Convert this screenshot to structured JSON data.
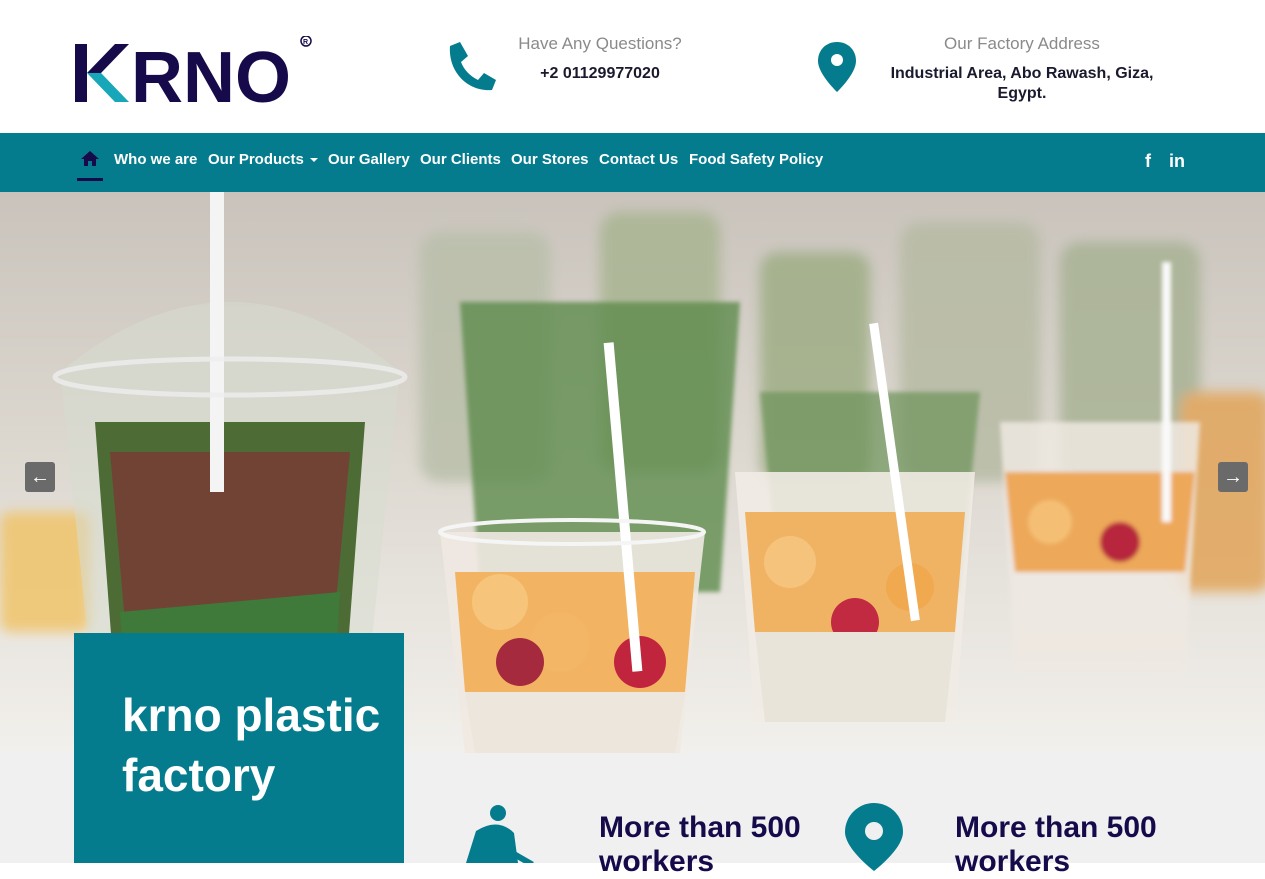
{
  "brand": {
    "logo_text": "KRNO",
    "registered": "®"
  },
  "header": {
    "questions_label": "Have Any Questions?",
    "phone": "+2 01129977020",
    "address_label": "Our Factory Address",
    "address": "Industrial Area, Abo Rawash, Giza, Egypt."
  },
  "nav": {
    "items": [
      "Who we are",
      "Our Products",
      "Our Gallery",
      "Our Clients",
      "Our Stores",
      "Contact Us",
      "Food Safety Policy"
    ],
    "social": {
      "facebook": "f",
      "linkedin": "in"
    }
  },
  "slider": {
    "prev": "←",
    "next": "→"
  },
  "hero": {
    "title": "krno plastic factory"
  },
  "stats": [
    {
      "text": "More than 500 workers"
    },
    {
      "text": "More than 500 workers"
    }
  ],
  "colors": {
    "primary": "#057c8e",
    "navy": "#160a4a",
    "accent": "#17a2b8"
  }
}
